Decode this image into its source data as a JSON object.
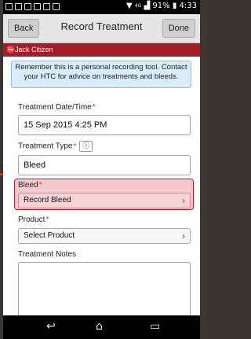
{
  "status_bar": {
    "battery": "91%",
    "time": "4:33",
    "network": "4G"
  },
  "toolbar": {
    "back_label": "Back",
    "title": "Record Treatment",
    "done_label": "Done"
  },
  "user": {
    "name": "Jack Citizen"
  },
  "notice": {
    "text": "Remember this is a personal recording tool. Contact your HTC for advice on treatments and bleeds."
  },
  "form": {
    "date_label": "Treatment Date/Time",
    "date_value": "15 Sep 2015 4:25 PM",
    "type_label": "Treatment Type",
    "type_value": "Bleed",
    "bleed_label": "Bleed",
    "bleed_button": "Record Bleed",
    "product_label": "Product",
    "product_button": "Select Product",
    "notes_label": "Treatment Notes",
    "required_mark": "*",
    "info_glyph": "ⓘ"
  },
  "colors": {
    "accent": "#a41d2b",
    "highlight_bg": "#f4c9ce",
    "notice_bg": "#d9ecf9"
  },
  "icons": {
    "nav_back": "back-icon",
    "nav_home": "home-icon",
    "nav_recent": "recent-apps-icon"
  }
}
